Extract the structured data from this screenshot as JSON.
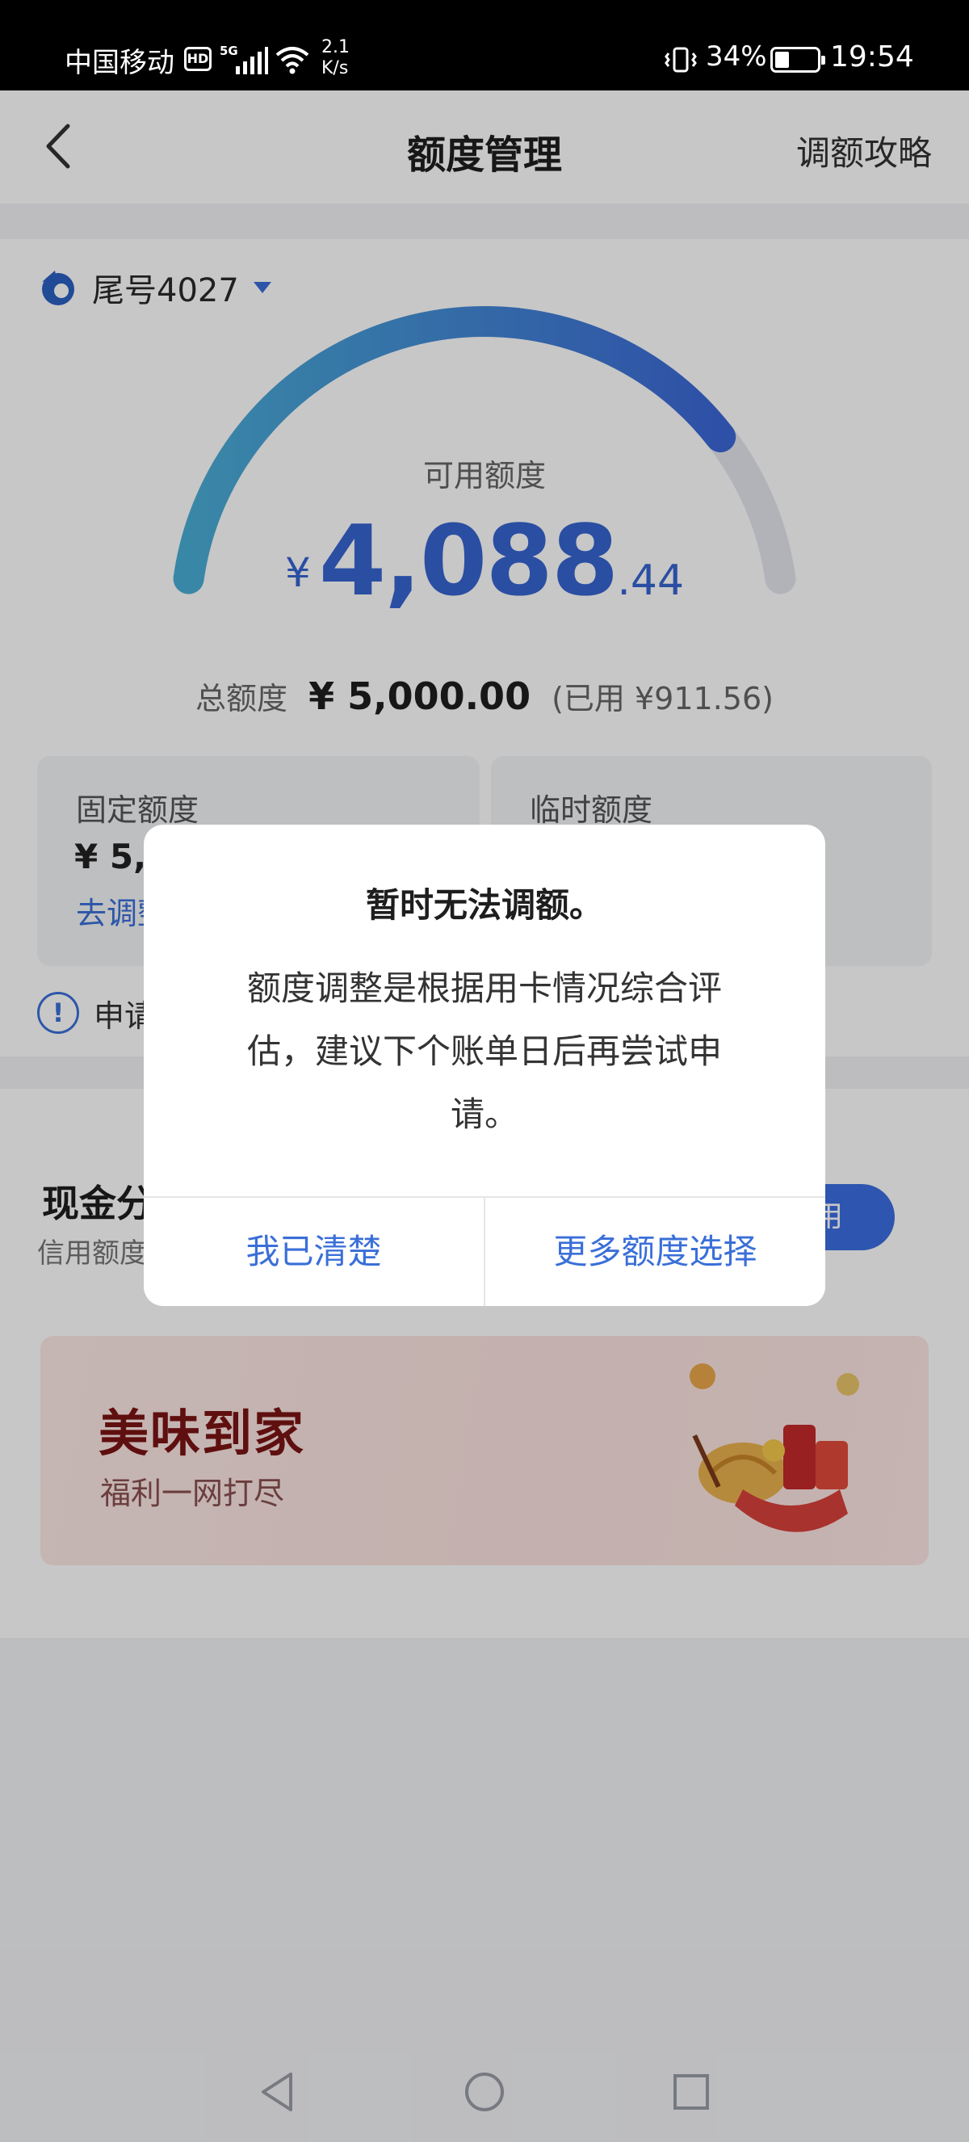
{
  "status_bar": {
    "carrier": "中国移动",
    "hd": "HD",
    "network": "5G",
    "speed_value": "2.1",
    "speed_unit": "K/s",
    "battery_percent": "34%",
    "battery_level": 0.34,
    "time": "19:54"
  },
  "header": {
    "title": "额度管理",
    "right_link": "调额攻略",
    "back_icon": "chevron-left-icon"
  },
  "account": {
    "label": "尾号4027",
    "logo_icon": "bank-logo-icon"
  },
  "credit": {
    "available_label": "可用额度",
    "currency_symbol": "¥",
    "available_integer": "4,088",
    "available_decimal": ".44",
    "used_fraction": 0.182,
    "total_label": "总额度",
    "total_value": "¥ 5,000.00",
    "used_text": "(已用 ¥911.56)",
    "gauge_colors": {
      "start": "#4aaed6",
      "end": "#3c67d6",
      "track": "#e3e6ee"
    }
  },
  "fixed_limit": {
    "title": "固定额度",
    "value_prefix": "¥ 5,0",
    "link": "去调整"
  },
  "temp_limit": {
    "title": "临时额度"
  },
  "notice": {
    "icon": "exclamation-circle-icon",
    "text_prefix": "申请"
  },
  "cash_section": {
    "title": "现金分",
    "subtitle": "信用额度",
    "button_fragment": "使用"
  },
  "banner": {
    "title": "美味到家",
    "subtitle": "福利一网打尽",
    "art_icon": "food-illustration"
  },
  "dialog": {
    "title": "暂时无法调额。",
    "message": "额度调整是根据用卡情况综合评估，建议下个账单日后再尝试申请。",
    "left_button": "我已清楚",
    "right_button": "更多额度选择"
  },
  "nav": {
    "back": "triangle-back-icon",
    "home": "circle-home-icon",
    "recent": "square-recent-icon"
  }
}
